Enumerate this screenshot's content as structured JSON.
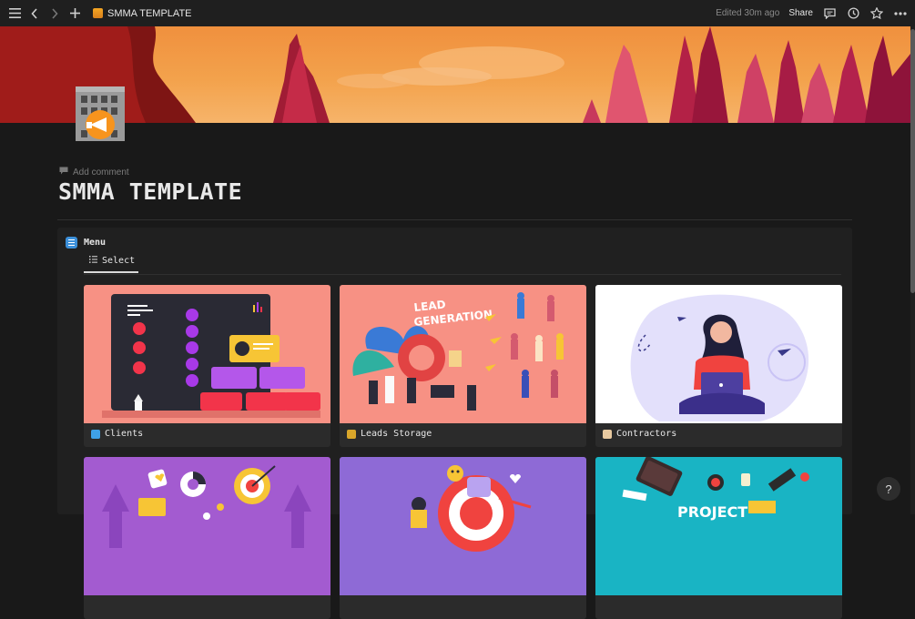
{
  "topbar": {
    "breadcrumb_title": "SMMA TEMPLATE",
    "edited": "Edited 30m ago",
    "share_label": "Share"
  },
  "page": {
    "add_comment": "Add comment",
    "title": "SMMA TEMPLATE"
  },
  "menu": {
    "title": "Menu",
    "tab_label": "Select",
    "cards": [
      {
        "label": "Clients",
        "image": "clients-illustration",
        "bg": "#f79184"
      },
      {
        "label": "Leads Storage",
        "image": "lead-generation-illustration",
        "bg": "#f79184"
      },
      {
        "label": "Contractors",
        "image": "contractor-illustration",
        "bg": "#ffffff"
      },
      {
        "label": "",
        "image": "marketing-illustration",
        "bg": "#a35bd0"
      },
      {
        "label": "",
        "image": "engagement-illustration",
        "bg": "#8e6ad6"
      },
      {
        "label": "",
        "image": "project-illustration",
        "bg": "#19b4c4"
      }
    ],
    "lead_image_text": [
      "LEAD",
      "GENERATION"
    ],
    "project_image_text": "PROJECT"
  },
  "help_label": "?"
}
